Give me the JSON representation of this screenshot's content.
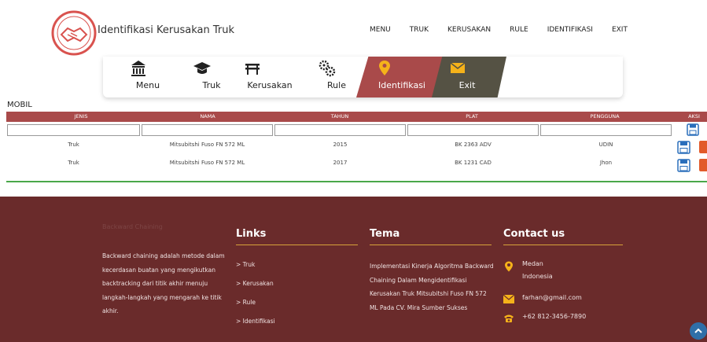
{
  "header": {
    "brand": "Identifikasi Kerusakan Truk",
    "logo_icon": "handshake-logo-icon",
    "nav": [
      "MENU",
      "TRUK",
      "KERUSAKAN",
      "RULE",
      "IDENTIFIKASI",
      "EXIT"
    ]
  },
  "tiles": [
    {
      "label": "Menu",
      "icon": "bank-icon"
    },
    {
      "label": "Truk",
      "icon": "graduation-cap-icon"
    },
    {
      "label": "Kerusakan",
      "icon": "bench-icon"
    },
    {
      "label": "Rule",
      "icon": "gears-icon"
    },
    {
      "label": "Identifikasi",
      "icon": "map-pin-icon"
    },
    {
      "label": "Exit",
      "icon": "envelope-icon"
    }
  ],
  "table": {
    "section_label": "MOBIL",
    "columns": [
      "JENIS",
      "NAMA",
      "TAHUN",
      "PLAT",
      "PENGGUNA",
      "AKSI"
    ],
    "rows": [
      {
        "jenis": "Truk",
        "nama": "Mitsubitshi Fuso FN 572 ML",
        "tahun": "2015",
        "plat": "BK 2363 ADV",
        "pengguna": "UDIN"
      },
      {
        "jenis": "Truk",
        "nama": "Mitsubitshi Fuso FN 572 ML",
        "tahun": "2017",
        "plat": "BK 1231 CAD",
        "pengguna": "Jhon"
      }
    ]
  },
  "footer": {
    "about": {
      "heading": "Backward Chaining",
      "text": "Backward chaining adalah metode dalam kecerdasan buatan yang mengikutkan backtracking dari titik akhir menuju langkah-langkah yang mengarah ke titik akhir."
    },
    "links": {
      "heading": "Links",
      "items": [
        "> Truk",
        "> Kerusakan",
        "> Rule",
        "> Identifikasi"
      ]
    },
    "tema": {
      "heading": "Tema",
      "text": "Implementasi Kinerja Algoritma Backward Chaining Dalam Mengidentifikasi Kerusakan Truk Mitsubitshi Fuso FN 572 ML Pada CV. Mira Sumber Sukses"
    },
    "contact": {
      "heading": "Contact us",
      "location": "Medan Indonesia",
      "email": "farhan@gmail.com",
      "phone": "+62 812-3456-7890"
    }
  },
  "colors": {
    "accent": "#a94a4a",
    "exit_tile": "#555244",
    "footer_bg": "#6a2b2b",
    "footer_rule": "#d6a23a",
    "divider": "#4aa84a",
    "save_blue": "#2a6ebb",
    "delete_orange": "#e25a2a"
  }
}
